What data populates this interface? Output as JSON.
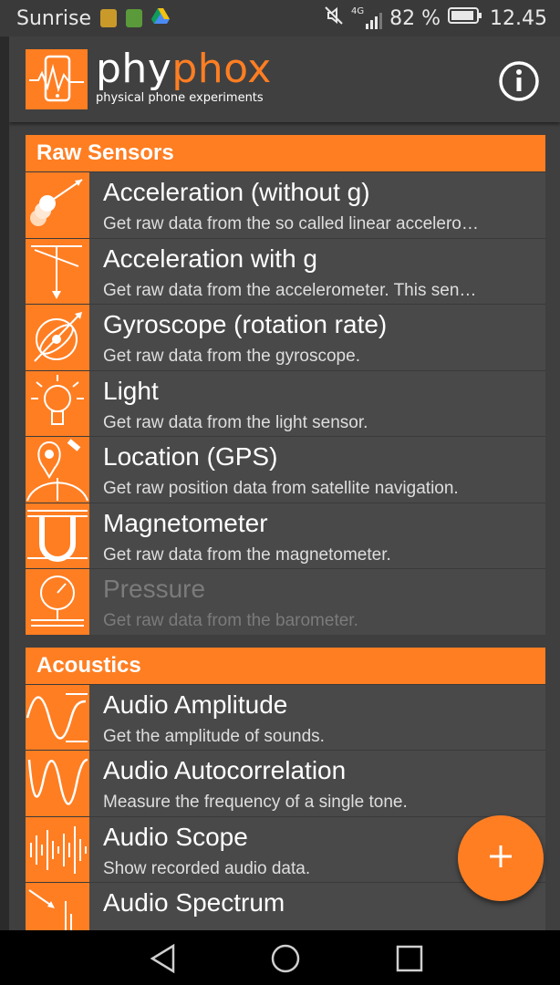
{
  "status_bar": {
    "carrier": "Sunrise",
    "network": "4G",
    "battery": "82 %",
    "time": "12.45"
  },
  "app": {
    "name_part1": "phy",
    "name_part2": "phox",
    "subtitle": "physical phone experiments",
    "info_icon": "info-icon"
  },
  "categories": [
    {
      "title": "Raw Sensors",
      "items": [
        {
          "title": "Acceleration (without g)",
          "desc": "Get raw data from the so called linear accelero…",
          "icon": "acceleration-icon",
          "enabled": true
        },
        {
          "title": "Acceleration with g",
          "desc": "Get raw data from the accelerometer. This sen…",
          "icon": "accelerometer-icon",
          "enabled": true
        },
        {
          "title": "Gyroscope (rotation rate)",
          "desc": "Get raw data from the gyroscope.",
          "icon": "gyroscope-icon",
          "enabled": true
        },
        {
          "title": "Light",
          "desc": "Get raw data from the light sensor.",
          "icon": "light-bulb-icon",
          "enabled": true
        },
        {
          "title": "Location (GPS)",
          "desc": "Get raw position data from satellite navigation.",
          "icon": "location-icon",
          "enabled": true
        },
        {
          "title": "Magnetometer",
          "desc": "Get raw data from the magnetometer.",
          "icon": "magnet-icon",
          "enabled": true
        },
        {
          "title": "Pressure",
          "desc": "Get raw data from the barometer.",
          "icon": "pressure-gauge-icon",
          "enabled": false
        }
      ]
    },
    {
      "title": "Acoustics",
      "items": [
        {
          "title": "Audio Amplitude",
          "desc": "Get the amplitude of sounds.",
          "icon": "audio-amplitude-icon",
          "enabled": true
        },
        {
          "title": "Audio Autocorrelation",
          "desc": "Measure the frequency of a single tone.",
          "icon": "audio-autocorrelation-icon",
          "enabled": true
        },
        {
          "title": "Audio Scope",
          "desc": "Show recorded audio data.",
          "icon": "audio-scope-icon",
          "enabled": true
        },
        {
          "title": "Audio Spectrum",
          "desc": "",
          "icon": "audio-spectrum-icon",
          "enabled": true
        }
      ]
    }
  ],
  "fab": {
    "icon": "plus-icon"
  },
  "navigation": {
    "back": "back-icon",
    "home": "home-icon",
    "recents": "recents-icon"
  },
  "colors": {
    "accent": "#ff7e22",
    "toolbar": "#404040",
    "item_bg": "#494949"
  }
}
